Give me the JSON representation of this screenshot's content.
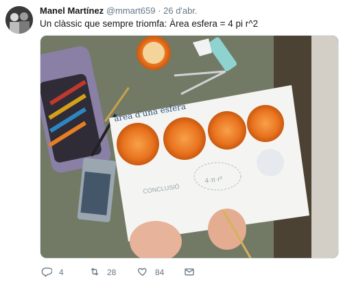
{
  "tweet": {
    "author_name": "Manel Martínez",
    "handle": "@mmart659",
    "separator": "·",
    "date": "26 d'abr.",
    "text": "Un clàssic que sempre triomfa: Àrea esfera = 4 pi r^2"
  },
  "photo": {
    "sheet_title": "àrea d'una esfera",
    "sheet_note": "CONCLUSIÓ",
    "sheet_formula": "4·π·r²"
  },
  "actions": {
    "reply_count": "4",
    "retweet_count": "28",
    "like_count": "84",
    "message_count": ""
  },
  "colors": {
    "text_primary": "#14171a",
    "text_secondary": "#657786",
    "border": "#e1e8ed"
  }
}
